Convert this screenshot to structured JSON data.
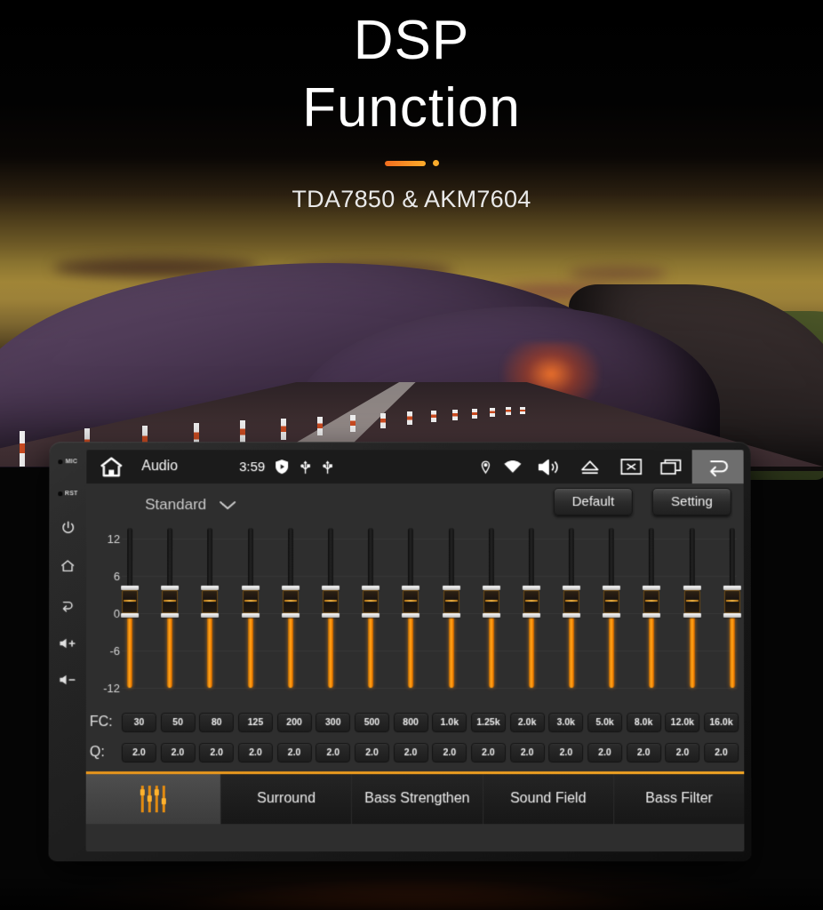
{
  "hero": {
    "title_line1": "DSP",
    "title_line2": "Function",
    "subtitle": "TDA7850 & AKM7604",
    "accent_color": "#f59a1e"
  },
  "device": {
    "bezel": {
      "mic_label": "MIC",
      "rst_label": "RST",
      "buttons": [
        "power-icon",
        "home-icon",
        "back-icon",
        "volume-up-icon",
        "volume-down-icon"
      ]
    },
    "statusbar": {
      "home_icon": "home-icon",
      "title": "Audio",
      "time": "3:59",
      "mid_icons": [
        "shield-play-icon",
        "usb-icon",
        "usb-icon"
      ],
      "right_icons": [
        "location-pin-icon",
        "wifi-icon",
        "volume-icon",
        "eject-icon",
        "close-x-icon",
        "recent-apps-icon",
        "back-arrow-icon"
      ],
      "active_right_icon": "back-arrow-icon"
    },
    "toolbar": {
      "preset_name": "Standard",
      "preset_chevron": "chevron-down-icon",
      "default_label": "Default",
      "setting_label": "Setting"
    },
    "equalizer": {
      "y_axis_labels": [
        "12",
        "6",
        "0",
        "-6",
        "-12"
      ],
      "y_min": -12,
      "y_max": 12,
      "band_count": 16,
      "fc_label": "FC:",
      "q_label": "Q:",
      "bands": [
        {
          "fc": "30",
          "q": "2.0",
          "gain": 0
        },
        {
          "fc": "50",
          "q": "2.0",
          "gain": 0
        },
        {
          "fc": "80",
          "q": "2.0",
          "gain": 0
        },
        {
          "fc": "125",
          "q": "2.0",
          "gain": 0
        },
        {
          "fc": "200",
          "q": "2.0",
          "gain": 0
        },
        {
          "fc": "300",
          "q": "2.0",
          "gain": 0
        },
        {
          "fc": "500",
          "q": "2.0",
          "gain": 0
        },
        {
          "fc": "800",
          "q": "2.0",
          "gain": 0
        },
        {
          "fc": "1.0k",
          "q": "2.0",
          "gain": 0
        },
        {
          "fc": "1.25k",
          "q": "2.0",
          "gain": 0
        },
        {
          "fc": "2.0k",
          "q": "2.0",
          "gain": 0
        },
        {
          "fc": "3.0k",
          "q": "2.0",
          "gain": 0
        },
        {
          "fc": "5.0k",
          "q": "2.0",
          "gain": 0
        },
        {
          "fc": "8.0k",
          "q": "2.0",
          "gain": 0
        },
        {
          "fc": "12.0k",
          "q": "2.0",
          "gain": 0
        },
        {
          "fc": "16.0k",
          "q": "2.0",
          "gain": 0
        }
      ]
    },
    "tabs": [
      {
        "label": "",
        "icon": "equalizer-icon",
        "active": true
      },
      {
        "label": "Surround",
        "icon": "",
        "active": false
      },
      {
        "label": "Bass Strengthen",
        "icon": "",
        "active": false
      },
      {
        "label": "Sound Field",
        "icon": "",
        "active": false
      },
      {
        "label": "Bass Filter",
        "icon": "",
        "active": false
      }
    ]
  }
}
